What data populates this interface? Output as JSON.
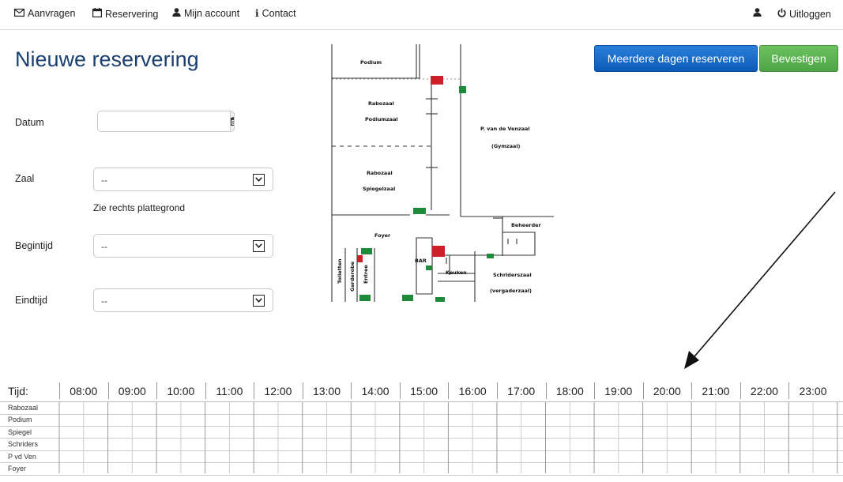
{
  "nav": {
    "items": [
      {
        "label": "Aanvragen",
        "icon": "envelope-icon"
      },
      {
        "label": "Reservering",
        "icon": "calendar-icon"
      },
      {
        "label": "Mijn account",
        "icon": "user-icon"
      },
      {
        "label": "Contact",
        "icon": "info-icon"
      }
    ],
    "user_icon": "user-icon",
    "logout": {
      "label": "Uitloggen",
      "icon": "power-icon"
    }
  },
  "page": {
    "title": "Nieuwe reservering"
  },
  "form": {
    "datum": {
      "label": "Datum",
      "value": "",
      "icon": "calendar-icon"
    },
    "zaal": {
      "label": "Zaal",
      "value": "--",
      "hint": "Zie rechts plattegrond"
    },
    "begintijd": {
      "label": "Begintijd",
      "value": "--"
    },
    "eindtijd": {
      "label": "Eindtijd",
      "value": "--"
    }
  },
  "buttons": {
    "multi": "Meerdere dagen reserveren",
    "confirm": "Bevestigen",
    "multi_color": "#0b5bb7",
    "confirm_color": "#4ea545"
  },
  "floorplan": {
    "labels": {
      "podium": "Podium",
      "rabozaal": "Rabozaal",
      "podiumzaal": "Podiumzaal",
      "venzaal": "P. van de Venzaal",
      "gymzaal": "(Gymzaal)",
      "rabozaal2": "Rabozaal",
      "spiegelzaal": "Spiegelzaal",
      "foyer": "Foyer",
      "beheerder": "Beheerder",
      "bar": "BAR",
      "keuken": "Keuken",
      "schriderszaal": "Schriderszaal",
      "vergaderzaal": "(vergaderzaal)",
      "toiletten": "Toiletten",
      "garderobe": "Garderobe",
      "entree": "Entree"
    }
  },
  "timetable": {
    "label": "Tijd:",
    "hours": [
      "08:00",
      "09:00",
      "10:00",
      "11:00",
      "12:00",
      "13:00",
      "14:00",
      "15:00",
      "16:00",
      "17:00",
      "18:00",
      "19:00",
      "20:00",
      "21:00",
      "22:00",
      "23:00"
    ],
    "rooms": [
      "Rabozaal",
      "Podium",
      "Spiegel",
      "Schriders",
      "P vd Ven",
      "Foyer"
    ]
  }
}
